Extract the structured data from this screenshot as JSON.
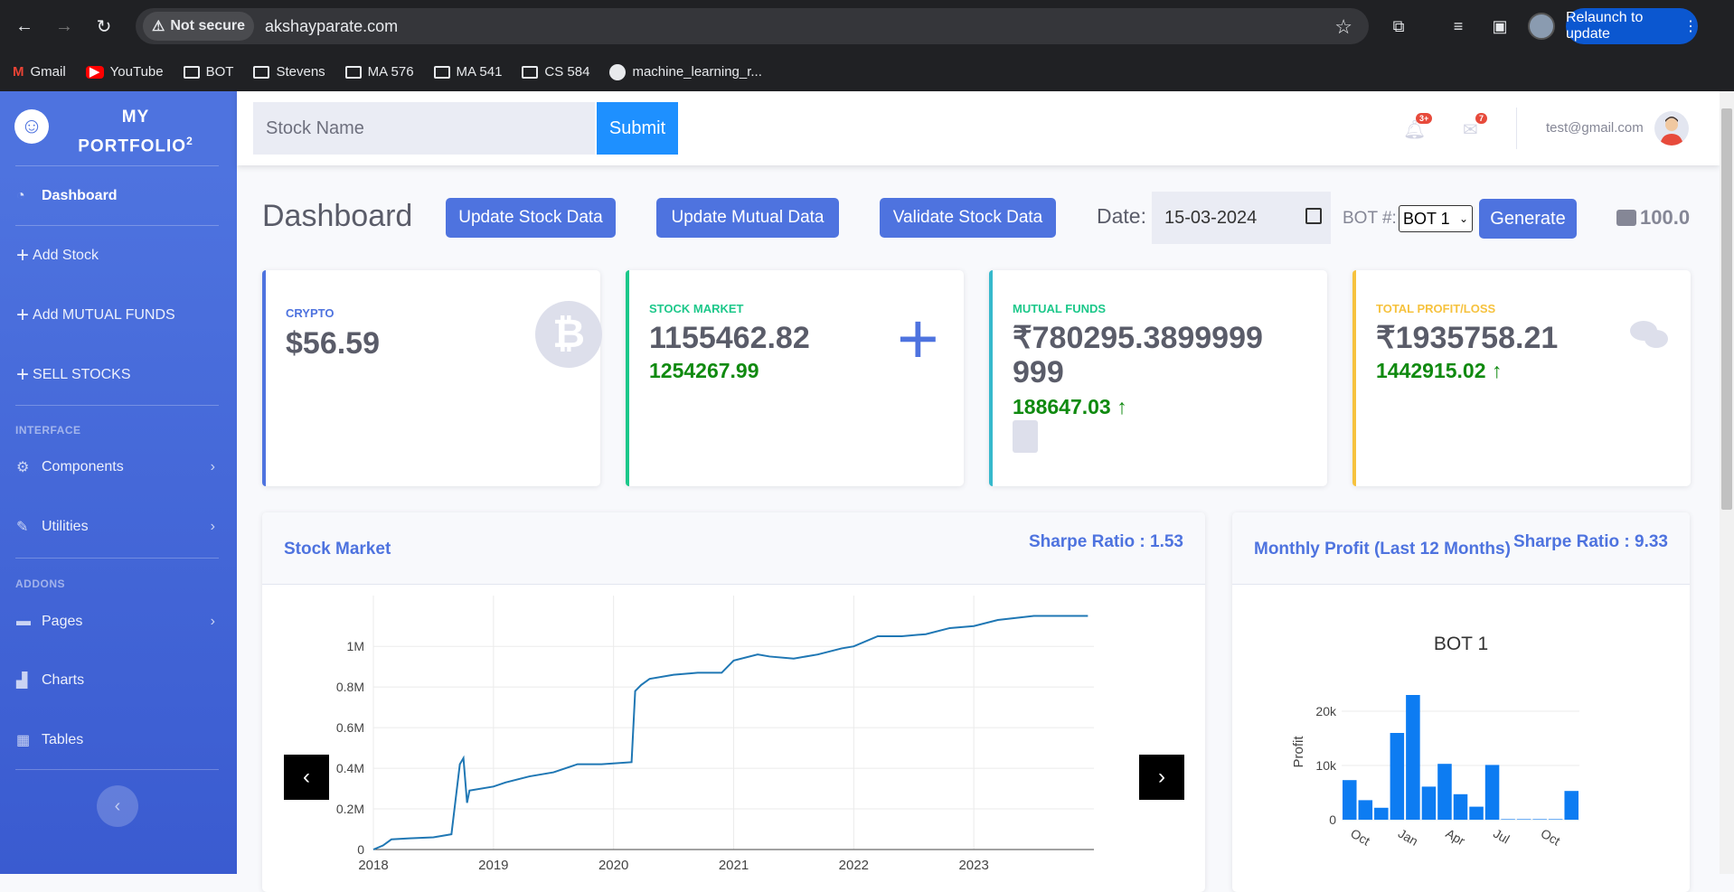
{
  "browser": {
    "security_label": "Not secure",
    "url": "akshayparate.com",
    "relaunch_label": "Relaunch to update",
    "bookmarks": [
      {
        "label": "Gmail",
        "icon": "gmail-icon"
      },
      {
        "label": "YouTube",
        "icon": "youtube-icon"
      },
      {
        "label": "BOT",
        "icon": "folder-icon"
      },
      {
        "label": "Stevens",
        "icon": "folder-icon"
      },
      {
        "label": "MA 576",
        "icon": "folder-icon"
      },
      {
        "label": "MA 541",
        "icon": "folder-icon"
      },
      {
        "label": "CS 584",
        "icon": "folder-icon"
      },
      {
        "label": "machine_learning_r...",
        "icon": "github-icon"
      }
    ]
  },
  "sidebar": {
    "brand_line1": "MY",
    "brand_line2": "PORTFOLIO",
    "brand_sup": "2",
    "items": [
      {
        "label": "Dashboard",
        "icon": "tachometer-icon"
      },
      {
        "label": "Add Stock",
        "icon": "plus-icon"
      },
      {
        "label": "Add MUTUAL FUNDS",
        "icon": "plus-icon"
      },
      {
        "label": "SELL STOCKS",
        "icon": "plus-icon"
      }
    ],
    "heading_interface": "INTERFACE",
    "interface_items": [
      {
        "label": "Components",
        "icon": "cog-icon"
      },
      {
        "label": "Utilities",
        "icon": "wrench-icon"
      }
    ],
    "heading_addons": "ADDONS",
    "addon_items": [
      {
        "label": "Pages",
        "icon": "folder-icon"
      },
      {
        "label": "Charts",
        "icon": "chart-icon"
      },
      {
        "label": "Tables",
        "icon": "table-icon"
      }
    ]
  },
  "topbar": {
    "search_placeholder": "Stock Name",
    "submit_label": "Submit",
    "alerts_count": "3+",
    "messages_count": "7",
    "user_email": "test@gmail.com"
  },
  "header": {
    "title": "Dashboard",
    "buttons": [
      "Update Stock Data",
      "Update Mutual Data",
      "Validate Stock Data"
    ],
    "date_label": "Date:",
    "date_value": "15-03-2024",
    "bot_label": "BOT #:",
    "bot_selected": "BOT 1",
    "generate_label": "Generate",
    "wallet_value": "100.0"
  },
  "cards": [
    {
      "label": "CRYPTO",
      "value": "$56.59",
      "color": "#4e73df"
    },
    {
      "label": "STOCK MARKET",
      "value": "1155462.82",
      "gain": "1254267.99",
      "color": "#1cc88a"
    },
    {
      "label": "MUTUAL FUNDS",
      "value_line1": "₹780295.3899999",
      "value_line2": "999",
      "gain": "188647.03 ↑",
      "color": "#36b9cc"
    },
    {
      "label": "TOTAL PROFIT/LOSS",
      "value": "₹1935758.21",
      "gain": "1442915.02 ↑",
      "color": "#f6c23e"
    }
  ],
  "stock_panel": {
    "title": "Stock Market",
    "sharpe": "Sharpe Ratio : 1.53"
  },
  "profit_panel": {
    "title": "Monthly Profit (Last 12 Months)",
    "sharpe": "Sharpe Ratio : 9.33"
  },
  "chart_data": [
    {
      "type": "line",
      "title": "",
      "x": [
        2018.0,
        2018.08,
        2018.15,
        2018.3,
        2018.5,
        2018.65,
        2018.72,
        2018.75,
        2018.78,
        2018.8,
        2019.0,
        2019.1,
        2019.3,
        2019.5,
        2019.7,
        2019.9,
        2020.15,
        2020.18,
        2020.23,
        2020.3,
        2020.5,
        2020.7,
        2020.9,
        2021.0,
        2021.2,
        2021.3,
        2021.5,
        2021.7,
        2021.9,
        2022.0,
        2022.2,
        2022.4,
        2022.6,
        2022.8,
        2023.0,
        2023.2,
        2023.5,
        2023.8,
        2023.95
      ],
      "y": [
        0,
        20000,
        50000,
        55000,
        60000,
        75000,
        420000,
        450000,
        230000,
        290000,
        310000,
        330000,
        360000,
        380000,
        420000,
        420000,
        430000,
        780000,
        810000,
        840000,
        860000,
        870000,
        870000,
        930000,
        960000,
        950000,
        940000,
        960000,
        990000,
        1000000,
        1050000,
        1050000,
        1060000,
        1090000,
        1100000,
        1130000,
        1150000,
        1150000,
        1150000
      ],
      "xlim": [
        2018,
        2024
      ],
      "ylim": [
        0,
        1150000
      ],
      "x_ticks": [
        "2018",
        "2019",
        "2020",
        "2021",
        "2022",
        "2023"
      ],
      "y_ticks": [
        "0",
        "0.2M",
        "0.4M",
        "0.6M",
        "0.8M",
        "1M"
      ],
      "color": "#1f77b4"
    },
    {
      "type": "bar",
      "title": "BOT 1",
      "ylabel": "Profit",
      "values": [
        7300,
        3600,
        2200,
        16000,
        23000,
        6100,
        10300,
        4700,
        2400,
        10100,
        100,
        100,
        100,
        100,
        5300
      ],
      "x_ticks": [
        "Oct",
        "Jan",
        "Apr",
        "Jul",
        "Oct"
      ],
      "y_ticks": [
        "0",
        "10k",
        "20k"
      ],
      "ylim": [
        0,
        25000
      ],
      "color": "#0d7cf2"
    }
  ]
}
